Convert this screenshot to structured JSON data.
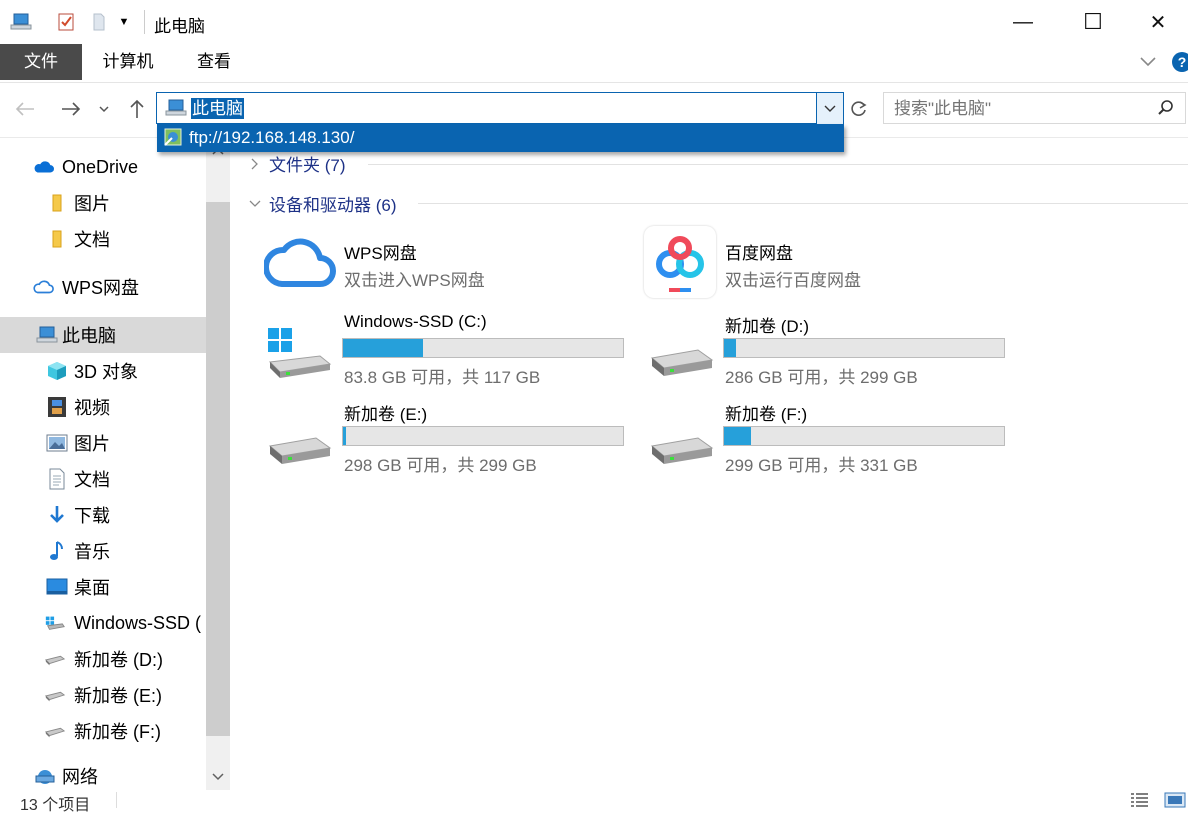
{
  "window": {
    "title": "此电脑",
    "minimize": "—",
    "maximize": "☐",
    "close": "✕"
  },
  "ribbon": {
    "tabs": [
      {
        "label": "文件"
      },
      {
        "label": "计算机"
      },
      {
        "label": "查看"
      }
    ],
    "help": "?"
  },
  "navbar": {
    "address": "此电脑",
    "search_placeholder": "搜索\"此电脑\""
  },
  "dropdown": {
    "suggestion": "ftp://192.168.148.130/"
  },
  "sidebar": {
    "items": [
      {
        "label": "OneDrive"
      },
      {
        "label": "图片"
      },
      {
        "label": "文档"
      },
      {
        "label": "WPS网盘"
      },
      {
        "label": "此电脑"
      },
      {
        "label": "3D 对象"
      },
      {
        "label": "视频"
      },
      {
        "label": "图片"
      },
      {
        "label": "文档"
      },
      {
        "label": "下载"
      },
      {
        "label": "音乐"
      },
      {
        "label": "桌面"
      },
      {
        "label": "Windows-SSD ("
      },
      {
        "label": "新加卷 (D:)"
      },
      {
        "label": "新加卷 (E:)"
      },
      {
        "label": "新加卷 (F:)"
      },
      {
        "label": "网络"
      }
    ]
  },
  "content": {
    "folders_header": "文件夹 (7)",
    "devices_header": "设备和驱动器 (6)",
    "cloud": [
      {
        "name": "WPS网盘",
        "sub": "双击进入WPS网盘"
      },
      {
        "name": "百度网盘",
        "sub": "双击运行百度网盘"
      }
    ],
    "drives": [
      {
        "name": "Windows-SSD (C:)",
        "sub": "83.8 GB 可用，共 117 GB",
        "used_fraction": 0.284
      },
      {
        "name": "新加卷 (D:)",
        "sub": "286 GB 可用，共 299 GB",
        "used_fraction": 0.043
      },
      {
        "name": "新加卷 (E:)",
        "sub": "298 GB 可用，共 299 GB",
        "used_fraction": 0.003
      },
      {
        "name": "新加卷 (F:)",
        "sub": "299 GB 可用，共 331 GB",
        "used_fraction": 0.097
      }
    ]
  },
  "status": {
    "count": "13 个项目"
  },
  "colors": {
    "accent": "#0a64b0",
    "bar_fill": "#26a0da",
    "group_header": "#1e3287"
  }
}
